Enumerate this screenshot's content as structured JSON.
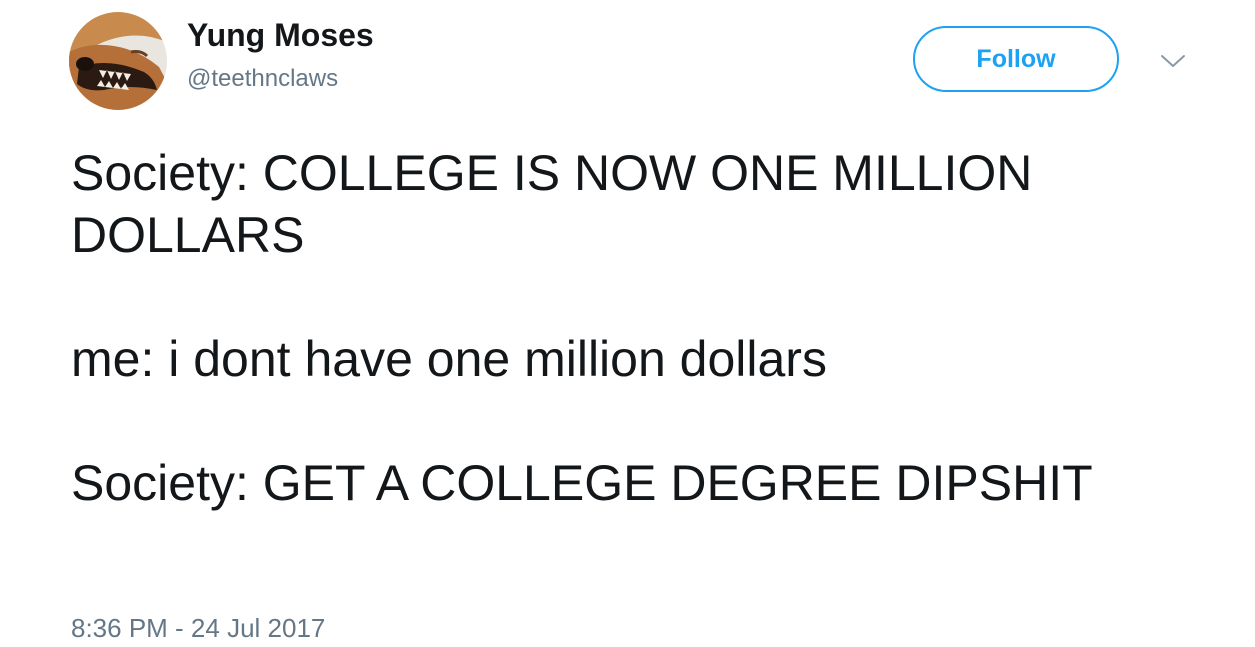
{
  "author": {
    "display_name": "Yung Moses",
    "handle": "@teethnclaws",
    "avatar_icon": "dog-avatar-icon"
  },
  "actions": {
    "follow_label": "Follow",
    "more_icon": "chevron-down-icon"
  },
  "tweet": {
    "lines": [
      "Society: COLLEGE IS NOW ONE MILLION DOLLARS",
      "me: i dont have one million dollars",
      "Society: GET A COLLEGE DEGREE DIPSHIT"
    ],
    "timestamp": "8:36 PM - 24 Jul 2017"
  },
  "colors": {
    "accent": "#1da1f2",
    "text": "#14171a",
    "secondary_text": "#657786"
  }
}
